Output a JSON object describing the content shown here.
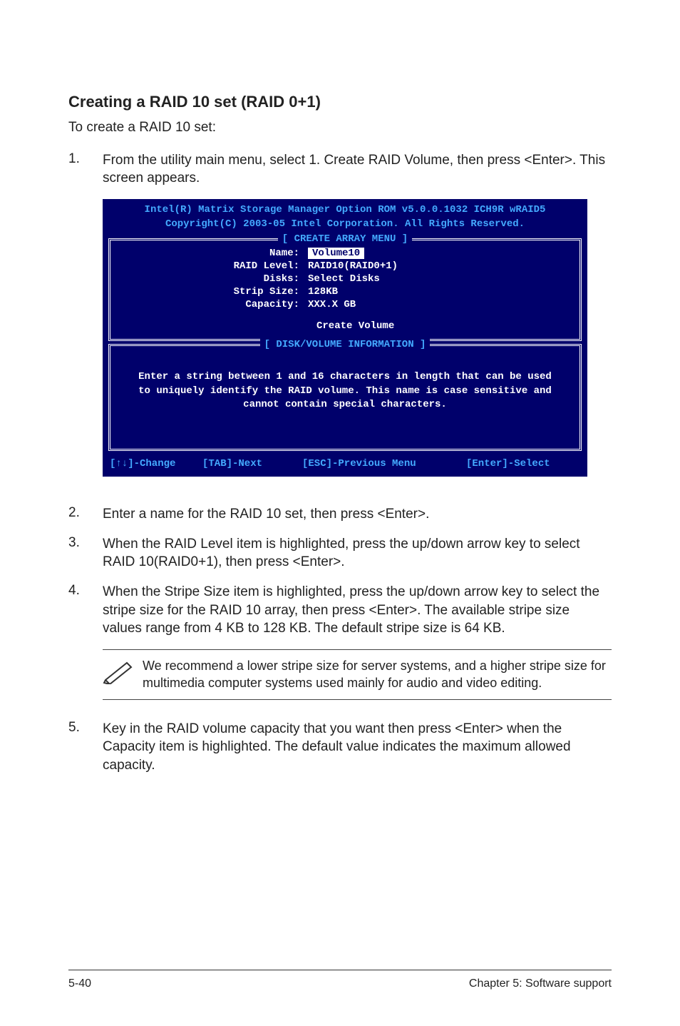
{
  "heading": "Creating a RAID 10 set (RAID 0+1)",
  "intro": "To create a RAID 10 set:",
  "steps": {
    "s1": {
      "num": "1.",
      "text": "From the utility main menu, select 1. Create RAID Volume, then press <Enter>. This screen appears."
    },
    "s2": {
      "num": "2.",
      "text": "Enter a name for the RAID 10 set, then press <Enter>."
    },
    "s3": {
      "num": "3.",
      "text": "When the RAID Level item is highlighted, press the up/down arrow key to select RAID 10(RAID0+1), then press <Enter>."
    },
    "s4": {
      "num": "4.",
      "text": "When the Stripe Size item is highlighted, press the up/down arrow key to select the stripe size for the RAID 10 array, then press <Enter>. The available stripe size values range from 4 KB to 128 KB. The default stripe size is 64 KB."
    },
    "s5": {
      "num": "5.",
      "text": "Key in the RAID volume capacity that you want then press <Enter> when the Capacity item is highlighted. The default value indicates the maximum allowed capacity."
    }
  },
  "console": {
    "header1": "Intel(R) Matrix Storage Manager Option ROM v5.0.0.1032 ICH9R wRAID5",
    "header2": "Copyright(C) 2003-05 Intel Corporation. All Rights Reserved.",
    "frame1_title": "[ CREATE ARRAY MENU ]",
    "fields": {
      "name_label": "Name:",
      "name_value": "Volume10",
      "raid_label": "RAID Level:",
      "raid_value": "RAID10(RAID0+1)",
      "disks_label": "Disks:",
      "disks_value": "Select Disks",
      "strip_label": "Strip Size:",
      "strip_value": "128KB",
      "capacity_label": "Capacity:",
      "capacity_value": "XXX.X GB"
    },
    "create_volume": "Create Volume",
    "frame2_title": "[ DISK/VOLUME INFORMATION ]",
    "disk_info_l1": "Enter a string between 1 and 16 characters in length that can be used",
    "disk_info_l2": "to uniquely identify the RAID volume. This name is case sensitive and",
    "disk_info_l3": "cannot contain special characters.",
    "footer": {
      "change": "[↑↓]-Change",
      "next": "[TAB]-Next",
      "prev": "[ESC]-Previous Menu",
      "select": "[Enter]-Select"
    }
  },
  "tip": "We recommend a lower stripe size for server systems, and a higher stripe size for multimedia computer systems used mainly for audio and video editing.",
  "footer": {
    "left": "5-40",
    "right": "Chapter 5: Software support"
  }
}
